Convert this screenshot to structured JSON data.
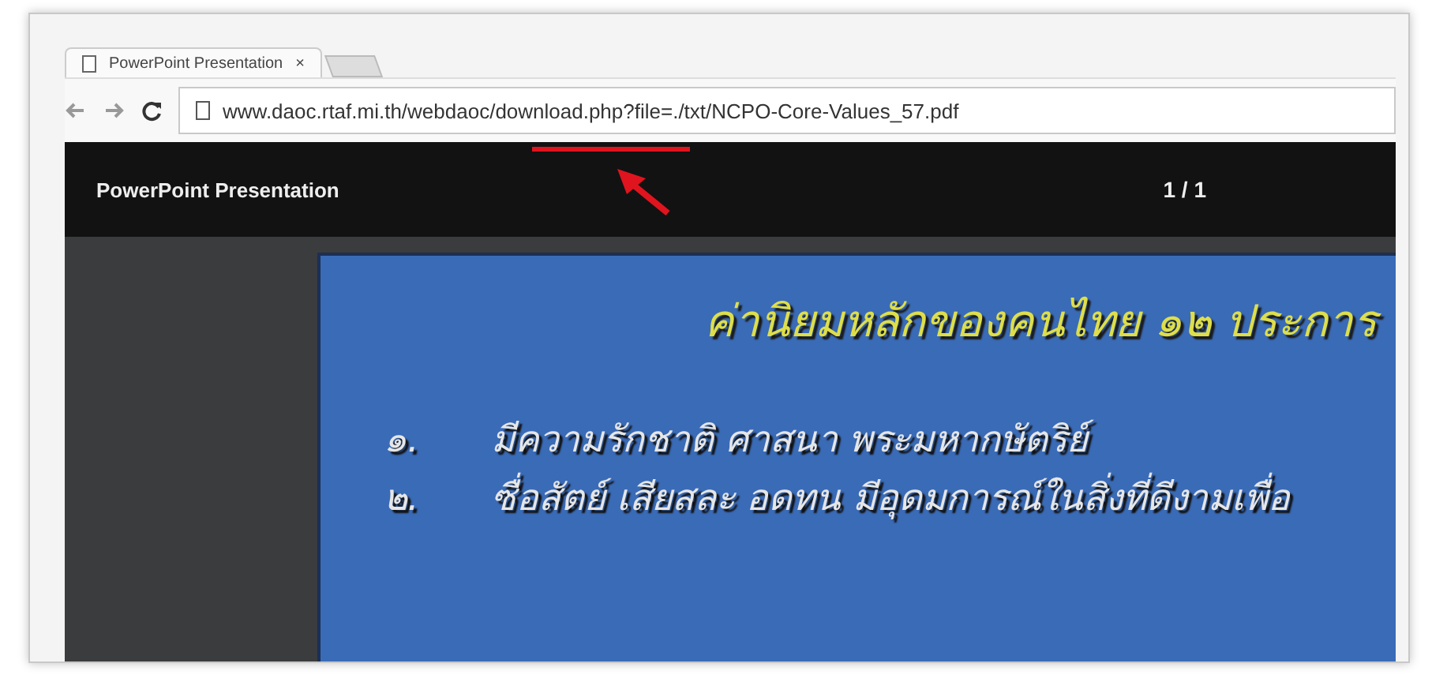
{
  "browser": {
    "tab": {
      "title": "PowerPoint Presentation",
      "close": "×"
    },
    "url": "www.daoc.rtaf.mi.th/webdaoc/download.php?file=./txt/NCPO-Core-Values_57.pdf"
  },
  "viewer": {
    "title": "PowerPoint Presentation",
    "page_counter": "1 / 1"
  },
  "slide": {
    "title": "ค่านิยมหลักของคนไทย ๑๒ ประการ",
    "items": [
      {
        "number": "๑.",
        "text": "มีความรักชาติ ศาสนา พระมหากษัตริย์"
      },
      {
        "number": "๒.",
        "text": "ซื่อสัตย์ เสียสละ อดทน มีอุดมการณ์ในสิ่งที่ดีงามเพื่อ"
      }
    ]
  }
}
